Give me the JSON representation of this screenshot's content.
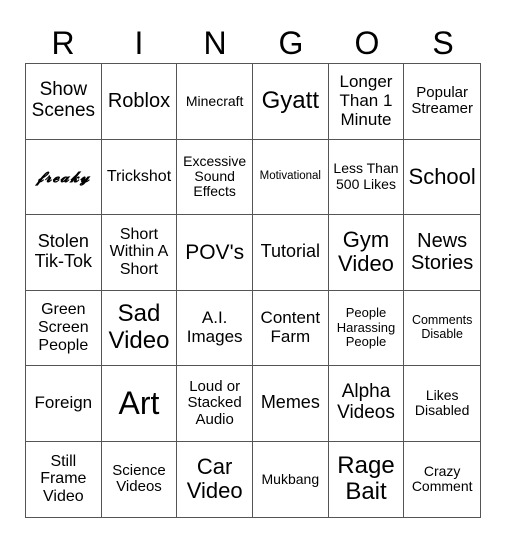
{
  "title_letters": [
    "R",
    "I",
    "N",
    "G",
    "O",
    "S"
  ],
  "cells": [
    [
      "Show Scenes",
      "Roblox",
      "Minecraft",
      "Gyatt",
      "Longer Than 1 Minute",
      "Popular Streamer"
    ],
    [
      "𝓯𝓻𝓮𝓪𝓴𝔂",
      "Trickshot",
      "Excessive Sound Effects",
      "Motivational",
      "Less Than 500 Likes",
      "School"
    ],
    [
      "Stolen Tik-Tok",
      "Short Within A Short",
      "POV's",
      "Tutorial",
      "Gym Video",
      "News Stories"
    ],
    [
      "Green Screen People",
      "Sad Video",
      "A.I. Images",
      "Content Farm",
      "People Harassing People",
      "Comments Disable"
    ],
    [
      "Foreign",
      "Art",
      "Loud or Stacked Audio",
      "Memes",
      "Alpha Videos",
      "Likes Disabled"
    ],
    [
      "Still Frame Video",
      "Science Videos",
      "Car Video",
      "Mukbang",
      "Rage Bait",
      "Crazy Comment"
    ]
  ]
}
